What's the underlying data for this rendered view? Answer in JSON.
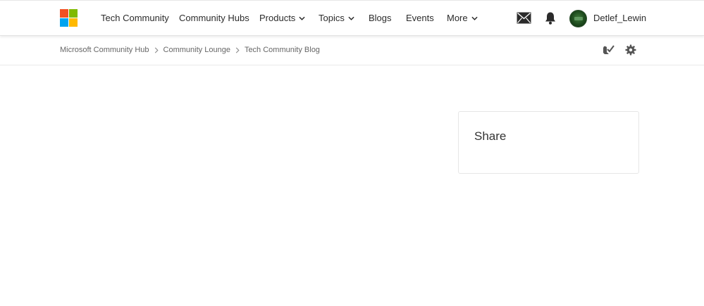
{
  "brand": {
    "logo_colors": [
      "#f25022",
      "#7fba00",
      "#00a4ef",
      "#ffb900"
    ]
  },
  "nav": {
    "items": [
      {
        "label": "Tech Community",
        "has_dropdown": false
      },
      {
        "label": "Community Hubs",
        "has_dropdown": false
      },
      {
        "label": "Products",
        "has_dropdown": true
      },
      {
        "label": "Topics",
        "has_dropdown": true
      },
      {
        "label": "Blogs",
        "has_dropdown": false
      },
      {
        "label": "Events",
        "has_dropdown": false
      },
      {
        "label": "More",
        "has_dropdown": true
      }
    ]
  },
  "header_icons": {
    "messages": "envelope-icon",
    "notifications": "bell-icon"
  },
  "user": {
    "username": "Detlef_Lewin"
  },
  "breadcrumb": {
    "items": [
      "Microsoft Community Hub",
      "Community Lounge",
      "Tech Community Blog"
    ]
  },
  "page_tools": {
    "subscribe": "subscribe-icon",
    "settings": "gear-icon"
  },
  "sidebar": {
    "share_title": "Share"
  }
}
